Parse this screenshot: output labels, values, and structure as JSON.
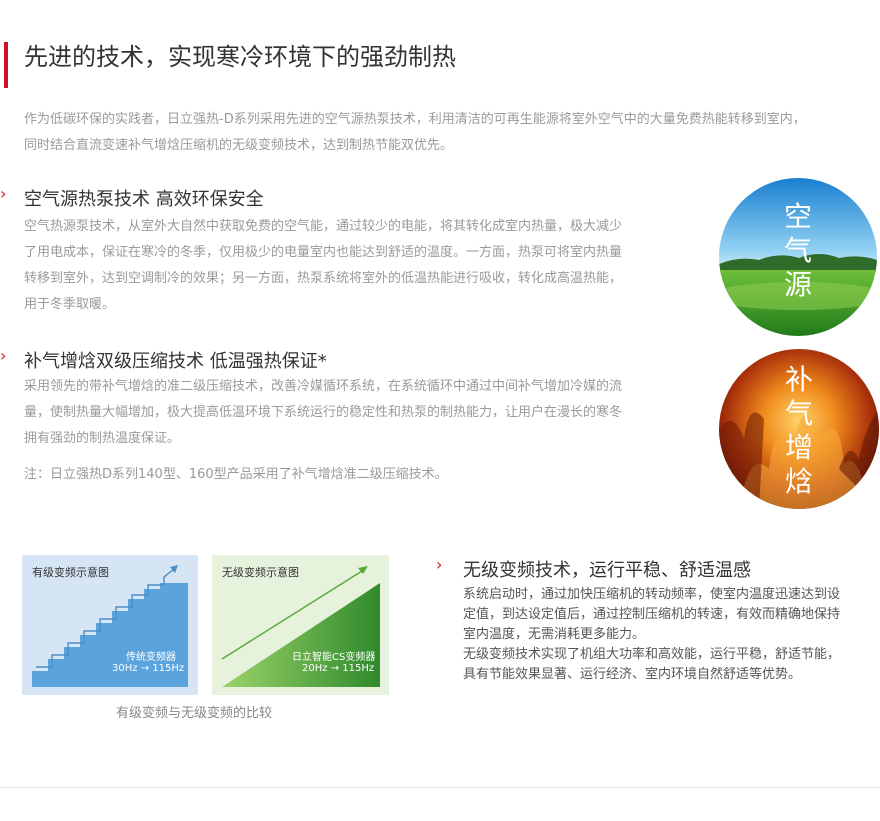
{
  "header": {
    "title": "先进的技术，实现寒冷环境下的强劲制热",
    "intro_line1": "作为低碳环保的实践者，日立强热-D系列采用先进的空气源热泵技术，利用清洁的可再生能源将室外空气中的大量免费热能转移到室内，",
    "intro_line2": "同时结合直流变速补气增焓压缩机的无级变频技术，达到制热节能双优先。"
  },
  "sections": [
    {
      "chevron": "›",
      "title": "空气源热泵技术 高效环保安全",
      "lines": [
        "空气热源泵技术，从室外大自然中获取免费的空气能，通过较少的电能，将其转化成室内热量，极大减少",
        "了用电成本，保证在寒冷的冬季，仅用极少的电量室内也能达到舒适的温度。一方面，热泵可将室内热量",
        "转移到室外，达到空调制冷的效果；另一方面，热泵系统将室外的低温热能进行吸收，转化成高温热能，",
        "用于冬季取暖。"
      ],
      "circle_chars": [
        "空",
        "气",
        "源"
      ]
    },
    {
      "chevron": "›",
      "title": "补气增焓双级压缩技术 低温强热保证*",
      "lines": [
        "采用领先的带补气增焓的准二级压缩技术，改善冷媒循环系统，在系统循环中通过中间补气增加冷媒的流",
        "量，使制热量大幅增加，极大提高低温环境下系统运行的稳定性和热泵的制热能力，让用户在漫长的寒冬",
        "拥有强劲的制热温度保证。"
      ],
      "note": "注：日立强热D系列140型、160型产品采用了补气增焓准二级压缩技术。",
      "circle_chars": [
        "补",
        "气",
        "增",
        "焓"
      ]
    }
  ],
  "diagram": {
    "left_panel_title": "有级变频示意图",
    "left_label": "传统变频器",
    "left_range_from": "30Hz",
    "left_range_to": "115Hz",
    "right_panel_title": "无级变频示意图",
    "right_label": "日立智能CS变频器",
    "right_range_from": "20Hz",
    "right_range_to": "115Hz",
    "caption": "有级变频与无级变频的比较",
    "arrow": "→"
  },
  "stepless": {
    "chevron": "›",
    "title": "无级变频技术，运行平稳、舒适温感",
    "lines": [
      "系统启动时，通过加快压缩机的转动频率，使室内温度迅速达到设",
      "定值，到达设定值后，通过控制压缩机的转速，有效而精确地保持",
      "室内温度，无需消耗更多能力。",
      "无级变频技术实现了机组大功率和高效能，运行平稳，舒适节能，",
      "具有节能效果显著、运行经济、室内环境自然舒适等优势。"
    ]
  },
  "colors": {
    "accent": "#d0112b",
    "muted_text": "#9a9a9a",
    "blue_step": "#5ba3dc",
    "green_ramp": "#3c9c3a"
  }
}
